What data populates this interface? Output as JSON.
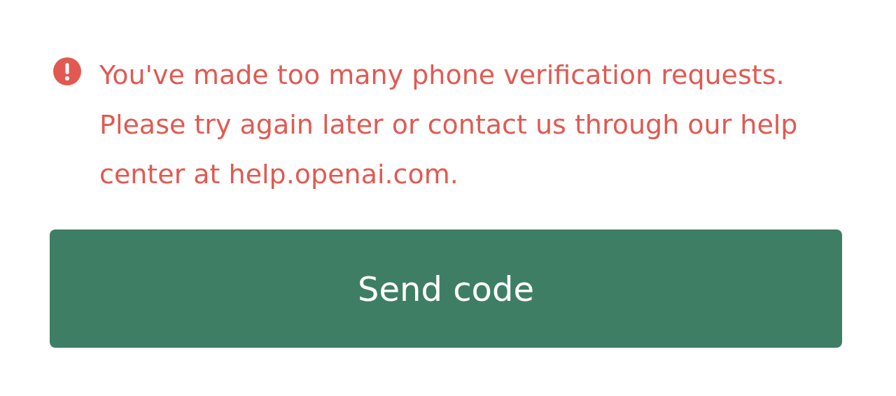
{
  "error": {
    "message": "You've made too many phone verification requests. Please try again later or contact us through our help center at help.openai.com."
  },
  "button": {
    "label": "Send code"
  }
}
